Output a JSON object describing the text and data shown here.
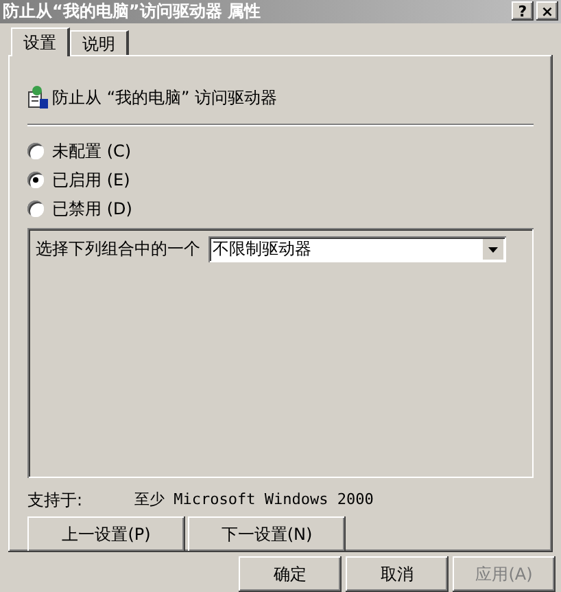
{
  "window": {
    "title": "防止从“我的电脑”访问驱动器 属性",
    "buttons": [
      "?",
      "×"
    ]
  },
  "tabs": [
    {
      "label": "设置",
      "selected": true
    },
    {
      "label": "说明",
      "selected": false
    }
  ],
  "policy": {
    "name": "防止从 “我的电脑” 访问驱动器"
  },
  "options": [
    {
      "label": "未配置 (C)",
      "selected": false
    },
    {
      "label": "已启用 (E)",
      "selected": true
    },
    {
      "label": "已禁用 (D)",
      "selected": false
    }
  ],
  "setting": {
    "label": "选择下列组合中的一个",
    "value": "不限制驱动器"
  },
  "support": {
    "label": "支持于:",
    "value": "至少 Microsoft Windows 2000"
  },
  "nav_buttons": [
    "上一设置(P)",
    "下一设置(N)"
  ],
  "dialog_buttons": [
    {
      "label": "确定",
      "disabled": false
    },
    {
      "label": "取消",
      "disabled": false
    },
    {
      "label": "应用(A)",
      "disabled": true
    }
  ]
}
